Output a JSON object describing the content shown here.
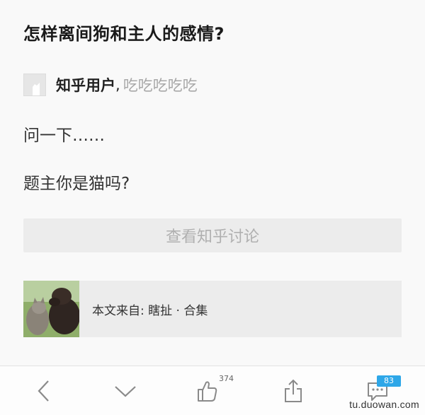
{
  "question": {
    "title": "怎样离间狗和主人的感情?"
  },
  "author": {
    "name": "知乎用户",
    "separator": ",",
    "bio": "吃吃吃吃吃"
  },
  "answer": {
    "paragraphs": [
      "问一下……",
      "题主你是猫吗?"
    ]
  },
  "view_button": {
    "label": "查看知乎讨论"
  },
  "source": {
    "text": "本文来自: 瞎扯 · 合集"
  },
  "bottom_bar": {
    "like_count": "374",
    "comment_count": "83",
    "icons": [
      "back-chevron-icon",
      "down-chevron-icon",
      "thumbs-up-icon",
      "share-icon",
      "comment-icon"
    ]
  },
  "watermark": {
    "text": "tu.duowan.com"
  },
  "colors": {
    "accent_badge": "#2ea7e8",
    "button_bg": "#ececec",
    "muted_text": "#a8a8a8"
  }
}
